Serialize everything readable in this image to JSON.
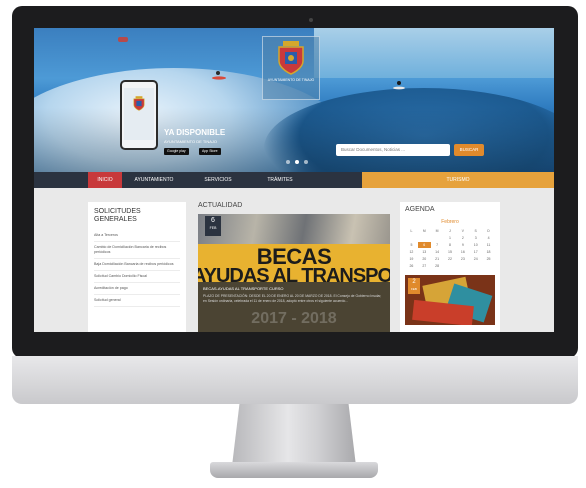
{
  "brand": {
    "mini_logo": "",
    "crest_caption": "AYUNTAMIENTO DE TINAJO"
  },
  "hero": {
    "promo_title": "YA DISPONIBLE",
    "promo_subtitle": "AYUNTAMIENTO DE TINAJO",
    "store_google": "Google play",
    "store_apple": "App Store",
    "slide_count": 3,
    "active_slide": 1
  },
  "search": {
    "placeholder": "Buscar Documentos, Noticias ...",
    "button_label": "BUSCAR"
  },
  "nav": {
    "items": [
      {
        "label": "INICIO"
      },
      {
        "label": "AYUNTAMIENTO"
      },
      {
        "label": "SERVICIOS"
      },
      {
        "label": "TRÁMITES"
      },
      {
        "label": "TURISMO"
      }
    ]
  },
  "sidebar": {
    "title": "SOLICITUDES GENERALES",
    "links": [
      "Alta a Terceros",
      "Cambio de Domiciliación Bancaria de recibos periódicos",
      "Baja Domiciliación Bancaria de recibos periódicos",
      "Solicitud Cambio Domicilio Fiscal",
      "Acreditación de pago",
      "Solicitud general"
    ]
  },
  "news": {
    "section_title": "ACTUALIDAD",
    "date_day": "6",
    "date_month": "FEB",
    "headline_line1": "BECAS",
    "headline_line2": "AYUDAS AL TRANSPOR",
    "ghost_text": "2017 - 2018",
    "item_title": "BECAS-AYUDAS AL TRANSPORTE CURSO",
    "item_text": "PLAZO DE PRESENTACIÓN: DESDE EL 20 DE ENERO AL 20 DE MARZO DE 2018. El Consejo de Gobierno Insular, en Sesión ordinaria, celebrada el 11 de enero de 2018, adoptó entre otros el siguiente acuerdo..."
  },
  "agenda": {
    "section_title": "AGENDA",
    "month": "Febrero",
    "weekdays": [
      "L",
      "M",
      "M",
      "J",
      "V",
      "S",
      "D"
    ],
    "days": [
      "",
      "",
      "",
      "1",
      "2",
      "3",
      "4",
      "5",
      "6",
      "7",
      "8",
      "9",
      "10",
      "11",
      "12",
      "13",
      "14",
      "15",
      "16",
      "17",
      "18",
      "19",
      "20",
      "21",
      "22",
      "23",
      "24",
      "25",
      "26",
      "27",
      "28",
      "",
      "",
      "",
      ""
    ],
    "today": "6",
    "event_day": "2",
    "event_month": "FEB"
  },
  "colors": {
    "nav_bg": "#2b3340",
    "nav_active": "#c8393b",
    "turismo": "#e6a23c",
    "accent": "#e08a2c"
  }
}
